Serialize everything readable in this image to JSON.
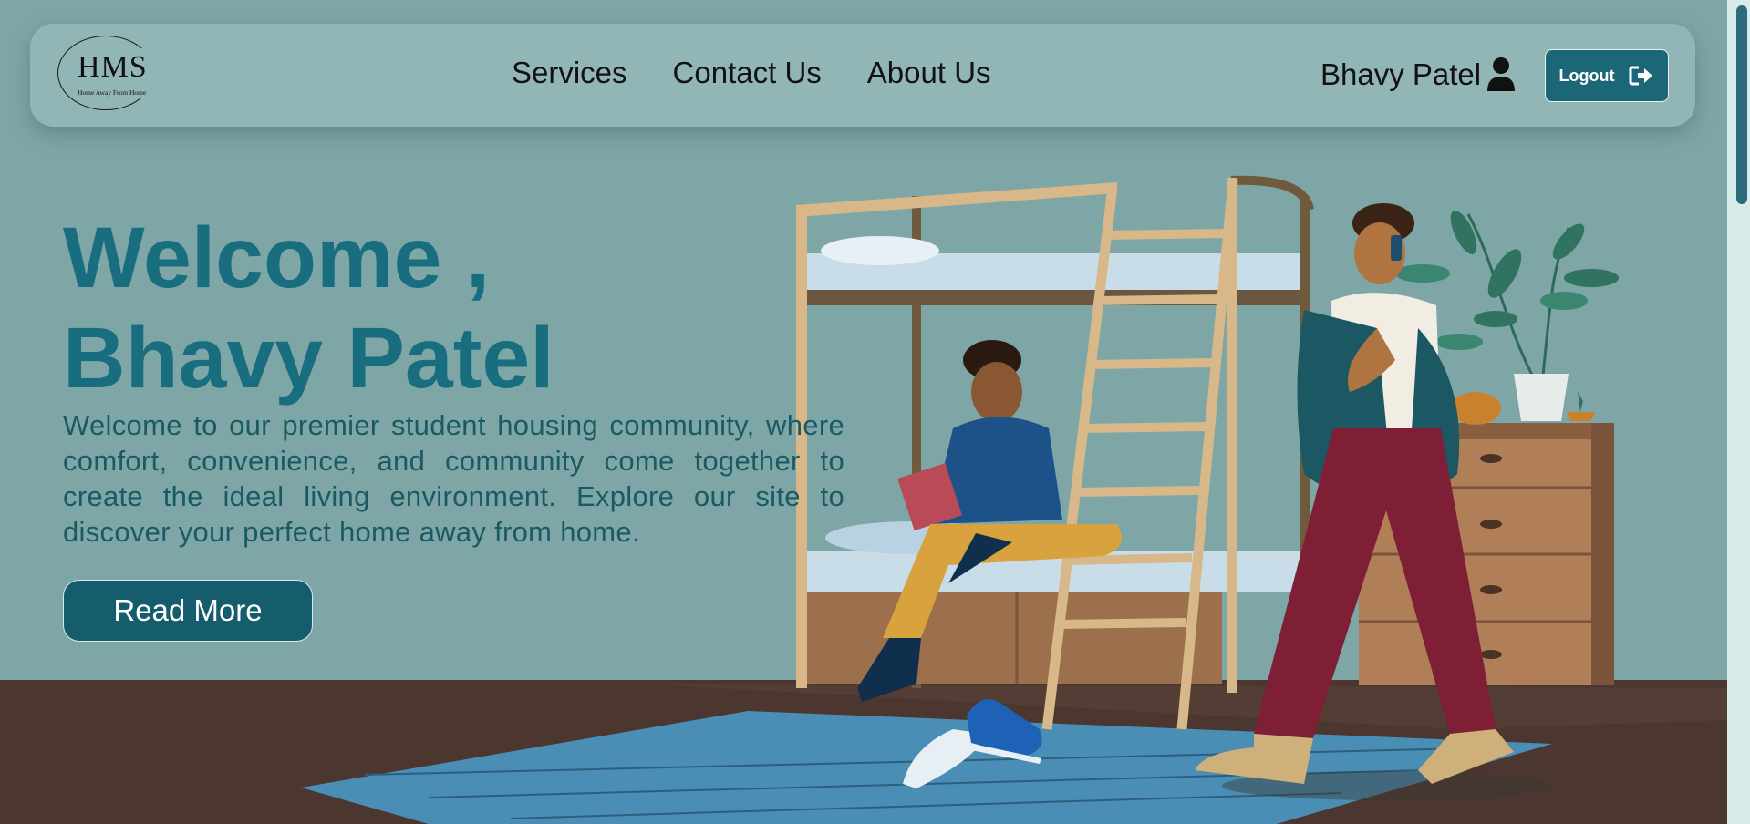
{
  "logo": {
    "main": "HMS",
    "tagline": "Home Away From Home"
  },
  "nav": {
    "links": [
      "Services",
      "Contact Us",
      "About Us"
    ]
  },
  "user": {
    "name": "Bhavy Patel",
    "icon": "user-icon"
  },
  "logout": {
    "label": "Logout",
    "icon": "sign-out-icon"
  },
  "hero": {
    "title_line1": "Welcome ,",
    "title_line2": "Bhavy Patel",
    "description": "Welcome to our premier student housing community, where comfort, convenience, and community come together to create the ideal living environment. Explore our site to discover your perfect home away from home.",
    "cta_label": "Read More"
  },
  "colors": {
    "brand": "#186e7e",
    "button": "#155d6c",
    "background": "#7fa6a6",
    "floor": "#4a3630",
    "rug": "#4a8eb6"
  }
}
